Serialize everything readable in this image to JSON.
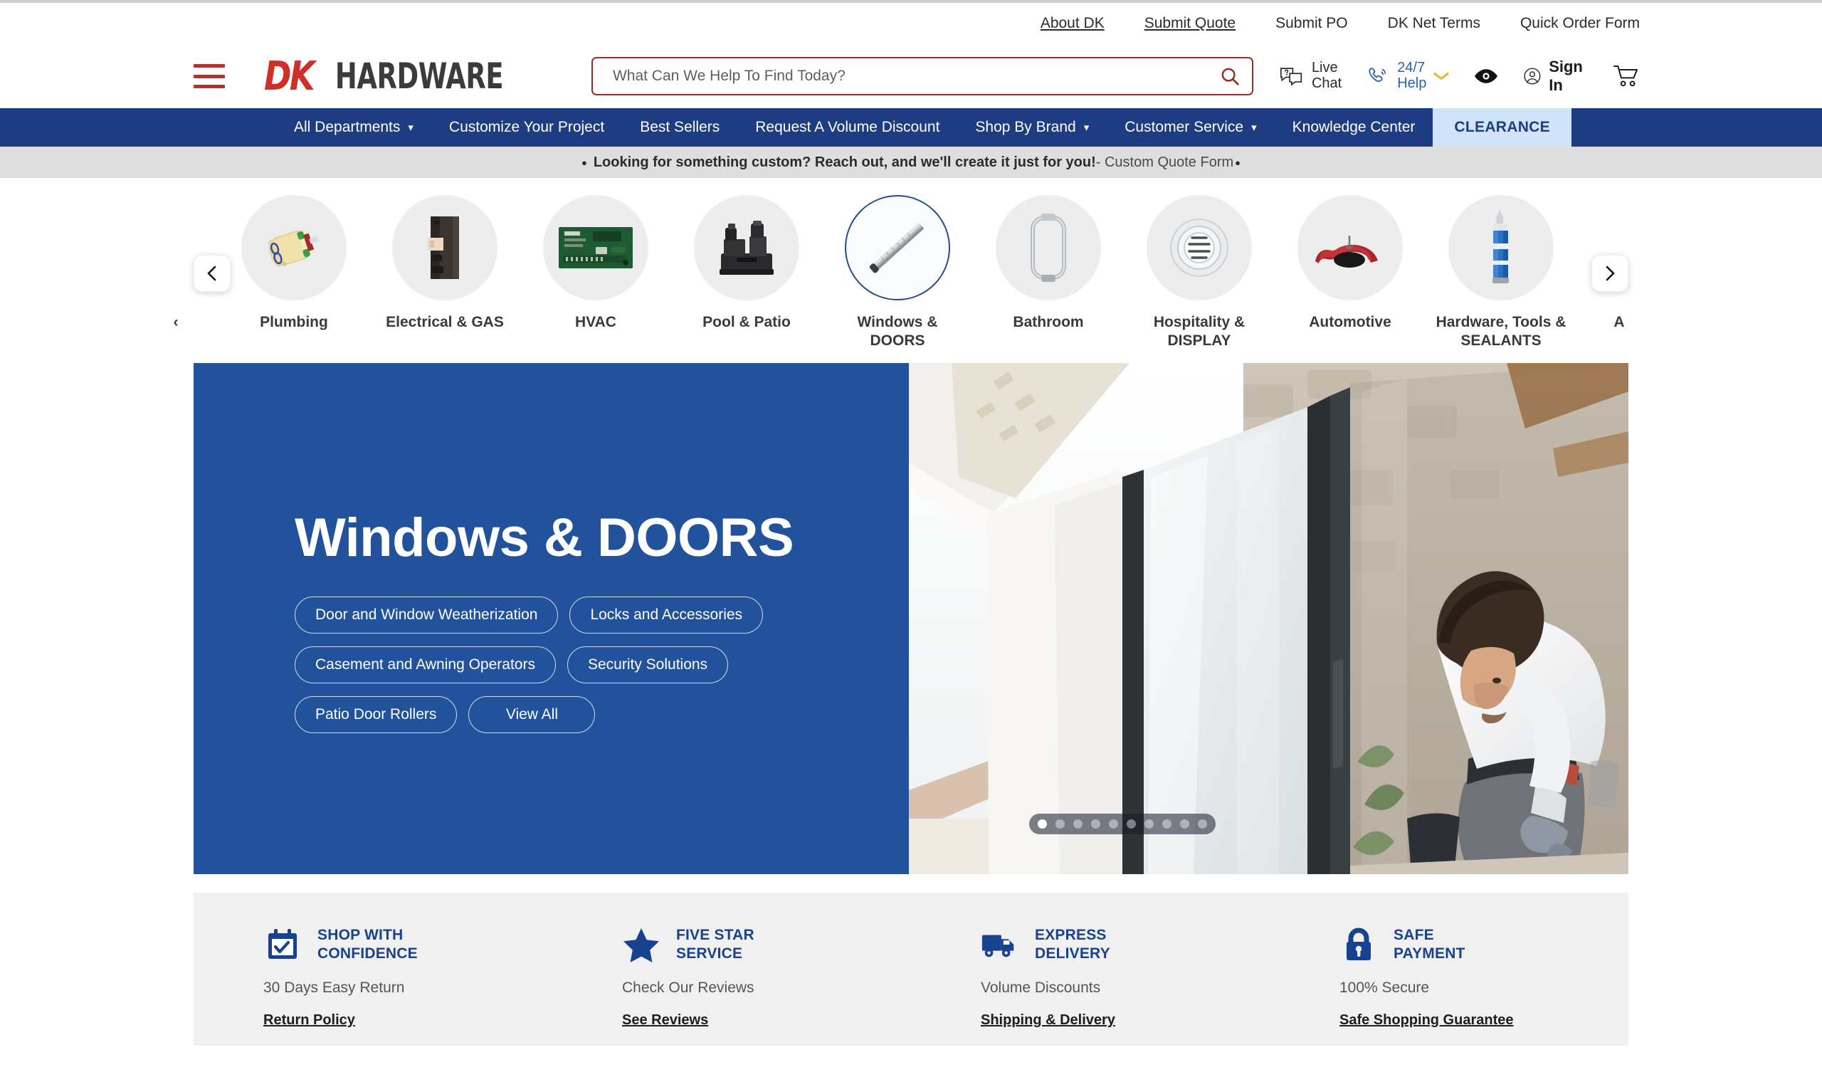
{
  "brand": {
    "logo_primary": "DK",
    "logo_secondary": "HARDWARE",
    "accent_red": "#cf2f26",
    "nav_blue": "#1e3c82",
    "hero_blue": "#21529b",
    "clearance_bg": "#cfe4f7"
  },
  "utility_links": [
    {
      "label": "About DK",
      "underline": true
    },
    {
      "label": "Submit Quote",
      "underline": true
    },
    {
      "label": "Submit PO",
      "underline": false
    },
    {
      "label": "DK Net Terms",
      "underline": false
    },
    {
      "label": "Quick Order Form",
      "underline": false
    }
  ],
  "search": {
    "placeholder": "What Can We Help To Find Today?",
    "value": "",
    "icon": "search-icon"
  },
  "header_actions": {
    "live_chat": {
      "line1": "Live",
      "line2": "Chat",
      "icon": "chat-question-icon"
    },
    "help": {
      "line1": "24/7",
      "line2": "Help",
      "icon": "phone-ring-icon",
      "chevron": "⌄"
    },
    "accessibility": {
      "icon": "eye-icon"
    },
    "account": {
      "label": "Sign In",
      "icon": "user-circle-icon"
    },
    "cart": {
      "icon": "shopping-cart-icon",
      "count": ""
    }
  },
  "main_nav": [
    {
      "label": "All Departments",
      "has_dropdown": true,
      "highlight": false
    },
    {
      "label": "Customize Your Project",
      "has_dropdown": false,
      "highlight": false
    },
    {
      "label": "Best Sellers",
      "has_dropdown": false,
      "highlight": false
    },
    {
      "label": "Request A Volume Discount",
      "has_dropdown": false,
      "highlight": false
    },
    {
      "label": "Shop By Brand",
      "has_dropdown": true,
      "highlight": false
    },
    {
      "label": "Customer Service",
      "has_dropdown": true,
      "highlight": false
    },
    {
      "label": "Knowledge Center",
      "has_dropdown": false,
      "highlight": false
    },
    {
      "label": "CLEARANCE",
      "has_dropdown": false,
      "highlight": true
    }
  ],
  "promo_bar": {
    "bullet_left": "●",
    "bold_text": "Looking for something custom? Reach out, and we'll create it just for you!",
    "light_text": " - Custom Quote Form ",
    "bullet_right": "●"
  },
  "category_carousel": {
    "prev_icon": "chevron-left-icon",
    "next_icon": "chevron-right-icon",
    "partial_left_label": "‹",
    "partial_right_label": "A",
    "items": [
      {
        "label": "Plumbing",
        "active": false,
        "thumb": "faucet-cartridge"
      },
      {
        "label": "Electrical & GAS",
        "active": false,
        "thumb": "circuit-breaker"
      },
      {
        "label": "HVAC",
        "active": false,
        "thumb": "control-board"
      },
      {
        "label": "Pool & Patio",
        "active": false,
        "thumb": "pump-manifold"
      },
      {
        "label": "Windows & DOORS",
        "active": true,
        "thumb": "door-rod"
      },
      {
        "label": "Bathroom",
        "active": false,
        "thumb": "shower-door-handle"
      },
      {
        "label": "Hospitality & DISPLAY",
        "active": false,
        "thumb": "round-vent"
      },
      {
        "label": "Automotive",
        "active": false,
        "thumb": "red-fender"
      },
      {
        "label": "Hardware, Tools & SEALANTS",
        "active": false,
        "thumb": "caulk-tube"
      }
    ]
  },
  "hero": {
    "title": "Windows & DOORS",
    "pills": [
      "Door and Window Weatherization",
      "Locks and Accessories",
      "Casement and Awning Operators",
      "Security Solutions",
      "Patio Door Rollers",
      "View All"
    ],
    "image_alt": "Worker installing a large sliding glass patio door",
    "carousel": {
      "total_slides": 10,
      "active_slide": 1
    }
  },
  "trust_badges": [
    {
      "icon": "calendar-check-icon",
      "title_line1": "SHOP WITH",
      "title_line2": "CONFIDENCE",
      "subtitle": "30 Days Easy Return",
      "link": "Return Policy"
    },
    {
      "icon": "star-icon",
      "title_line1": "FIVE STAR",
      "title_line2": "SERVICE",
      "subtitle": "Check Our Reviews",
      "link": "See Reviews"
    },
    {
      "icon": "delivery-truck-icon",
      "title_line1": "EXPRESS",
      "title_line2": "DELIVERY",
      "subtitle": "Volume Discounts",
      "link": "Shipping & Delivery"
    },
    {
      "icon": "lock-icon",
      "title_line1": "SAFE",
      "title_line2": "PAYMENT",
      "subtitle": "100% Secure",
      "link": "Safe Shopping Guarantee"
    }
  ]
}
